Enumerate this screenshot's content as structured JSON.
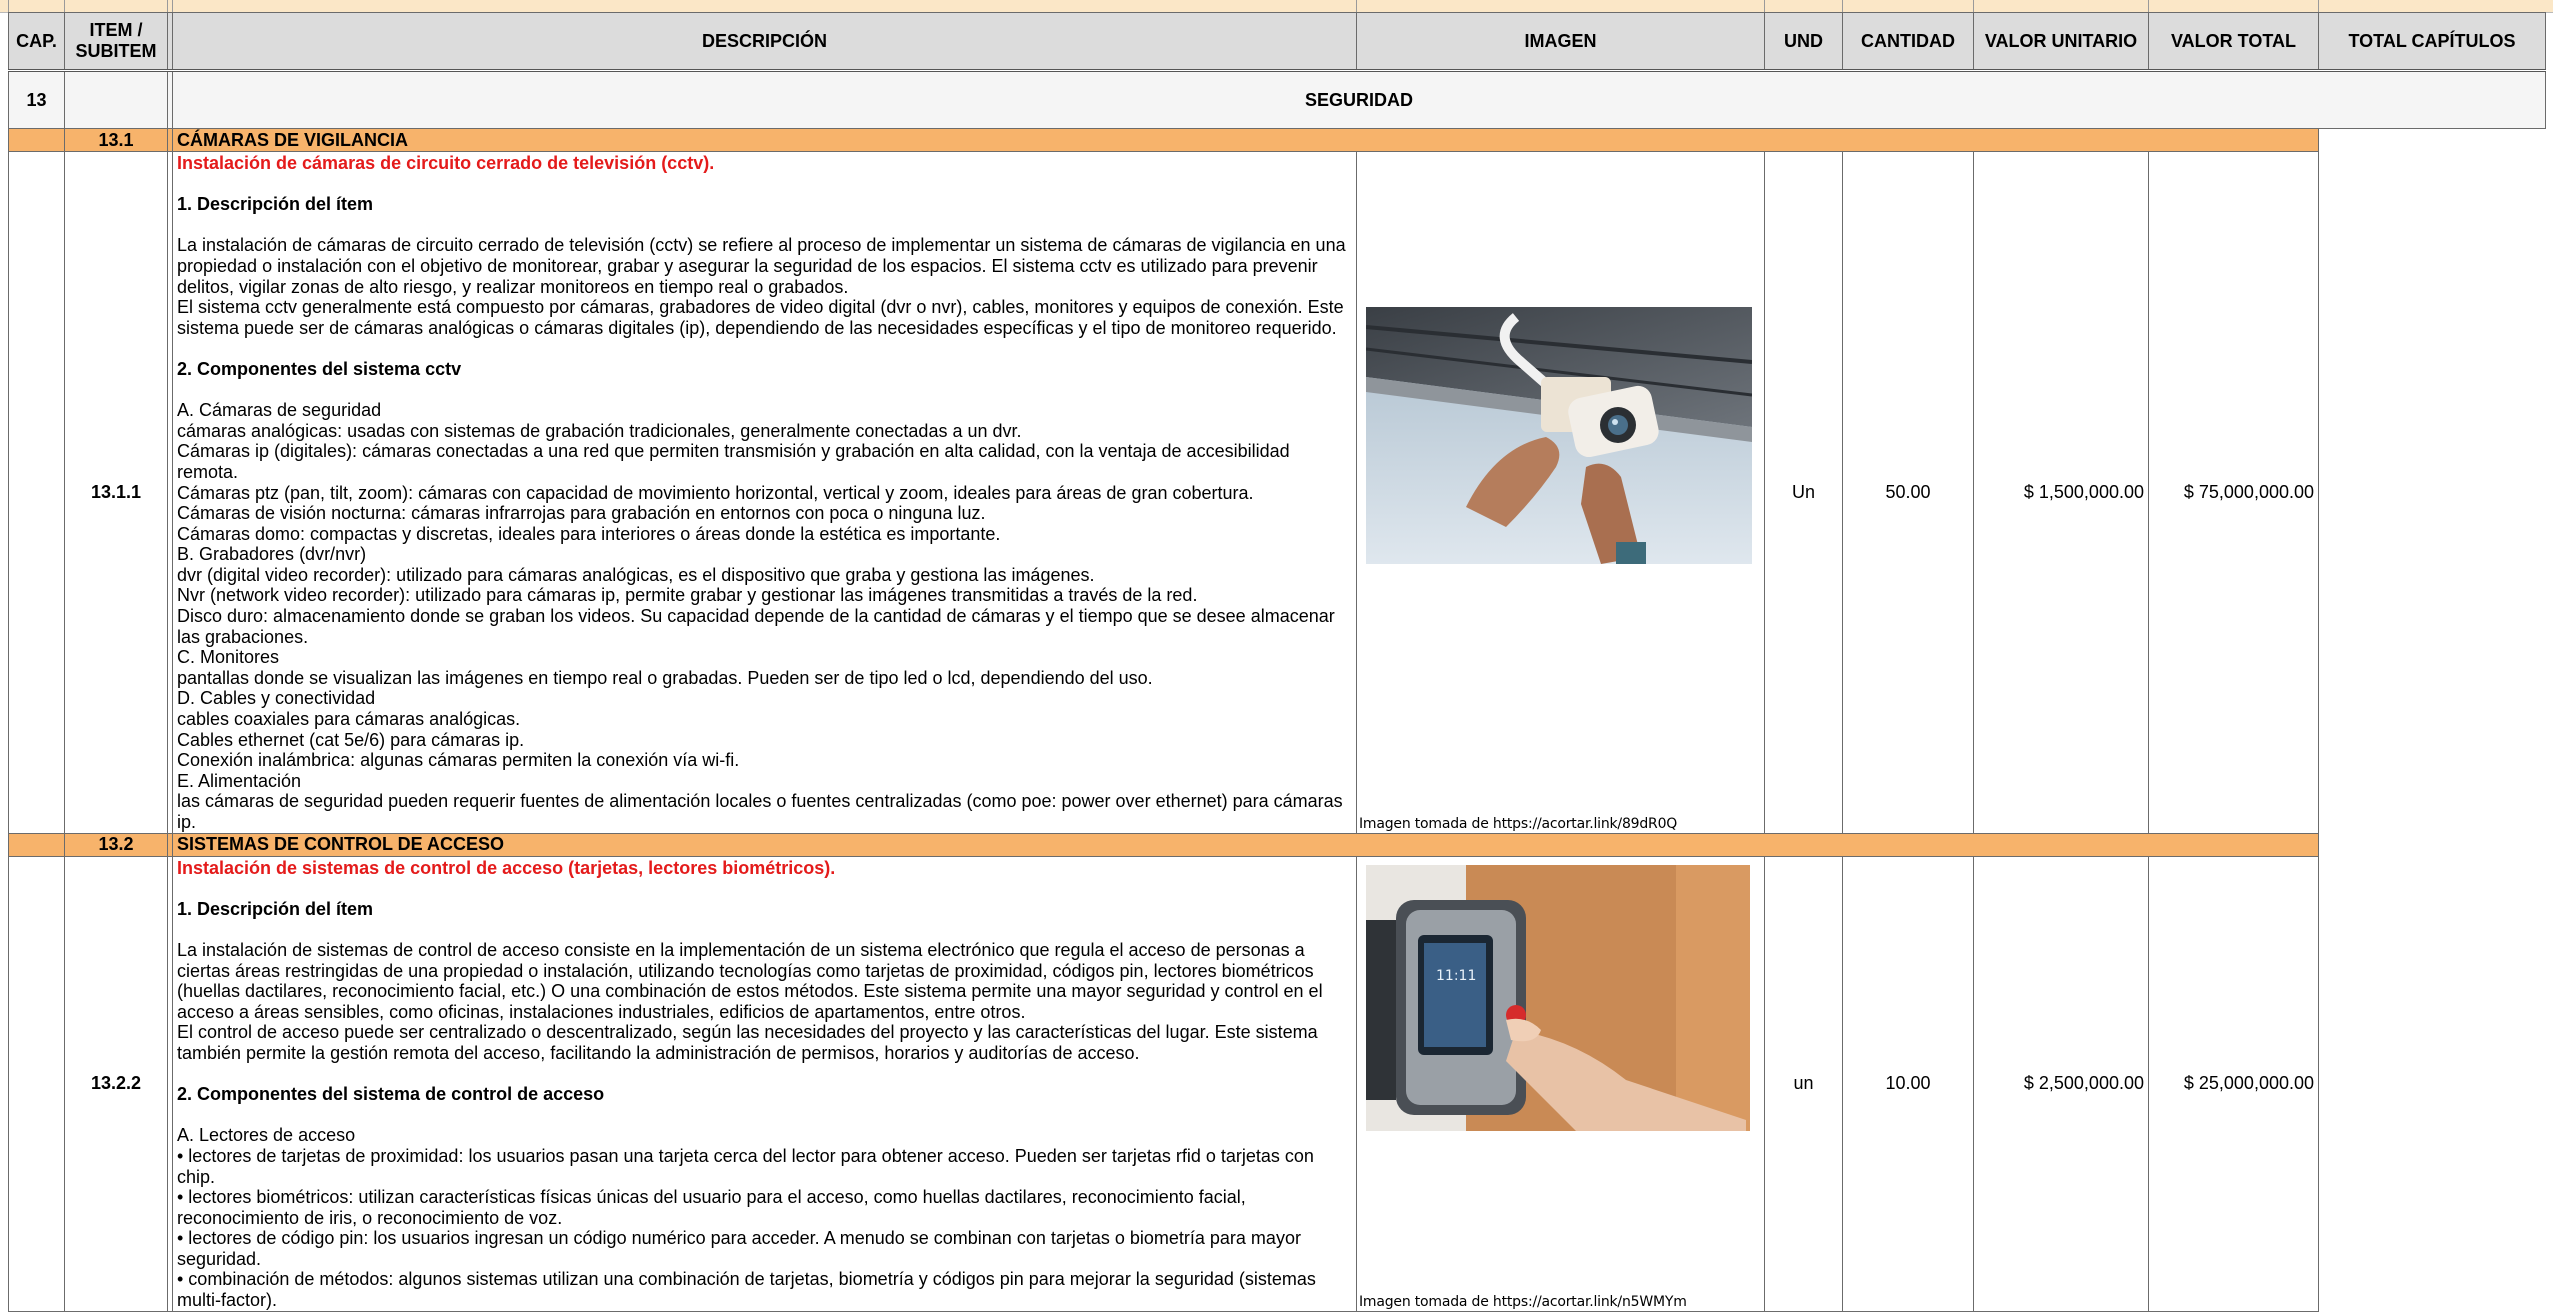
{
  "headers": {
    "cap": "CAP.",
    "item": "ITEM /\nSUBITEM",
    "item_line1": "ITEM /",
    "item_line2": "SUBITEM",
    "descripcion": "DESCRIPCIÓN",
    "imagen": "IMAGEN",
    "und": "UND",
    "cantidad": "CANTIDAD",
    "valor_unitario": "VALOR UNITARIO",
    "valor_total": "VALOR TOTAL",
    "total_capitulos": "TOTAL CAPÍTULOS"
  },
  "chapter": {
    "number": "13",
    "title": "SEGURIDAD"
  },
  "sections": [
    {
      "code": "13.1",
      "title": "CÁMARAS DE VIGILANCIA",
      "item": {
        "code": "13.1.1",
        "red_title": "Instalación de cámaras de circuito cerrado de televisión (cctv).",
        "heading1": "1. Descripción del ítem",
        "para1_lines": [
          "La instalación de cámaras de circuito cerrado de televisión (cctv) se refiere al proceso de implementar un sistema de cámaras de vigilancia en una",
          "propiedad o instalación con el objetivo de monitorear, grabar y asegurar la seguridad de los espacios. El sistema cctv es utilizado para prevenir",
          "delitos, vigilar zonas de alto riesgo, y realizar monitoreos en tiempo real o grabados.",
          "El sistema cctv generalmente está compuesto por cámaras, grabadores de video digital (dvr o nvr), cables, monitores y equipos de conexión. Este",
          "sistema puede ser de cámaras analógicas o cámaras digitales (ip), dependiendo de las necesidades específicas y el tipo de monitoreo requerido."
        ],
        "heading2": "2. Componentes del sistema cctv",
        "list_lines": [
          "A. Cámaras de seguridad",
          "cámaras analógicas: usadas con sistemas de grabación tradicionales, generalmente conectadas a un dvr.",
          "Cámaras ip (digitales): cámaras conectadas a una red que permiten transmisión y grabación en alta calidad, con la ventaja de accesibilidad remota.",
          "Cámaras ptz (pan, tilt, zoom): cámaras con capacidad de movimiento horizontal, vertical y zoom, ideales para áreas de gran cobertura.",
          "Cámaras de visión nocturna: cámaras infrarrojas para grabación en entornos con poca o ninguna luz.",
          "Cámaras domo: compactas y discretas, ideales para interiores o áreas donde la estética es importante.",
          "B. Grabadores (dvr/nvr)",
          "dvr (digital video recorder): utilizado para cámaras analógicas, es el dispositivo que graba y gestiona las imágenes.",
          "Nvr (network video recorder): utilizado para cámaras ip, permite grabar y gestionar las imágenes transmitidas a través de la red.",
          "Disco duro: almacenamiento donde se graban los videos. Su capacidad depende de la cantidad de cámaras y el tiempo que se desee almacenar",
          "las grabaciones.",
          "C. Monitores",
          "pantallas donde se visualizan las imágenes en tiempo real o grabadas. Pueden ser de tipo led o lcd, dependiendo del uso.",
          "D. Cables y conectividad",
          "cables coaxiales para cámaras analógicas.",
          "Cables ethernet (cat 5e/6) para cámaras ip.",
          "Conexión inalámbrica: algunas cámaras permiten la conexión vía wi-fi.",
          "E. Alimentación",
          "las cámaras de seguridad pueden requerir fuentes de alimentación locales o fuentes centralizadas (como poe: power over ethernet) para cámaras",
          "ip."
        ],
        "image_credit": "Imagen tomada de https://acortar.link/89dR0Q",
        "und": "Un",
        "cantidad": "50.00",
        "valor_unitario": "$ 1,500,000.00",
        "valor_total": "$ 75,000,000.00"
      }
    },
    {
      "code": "13.2",
      "title": "SISTEMAS DE CONTROL DE ACCESO",
      "item": {
        "code": "13.2.2",
        "red_title": "Instalación de sistemas de control de acceso (tarjetas, lectores biométricos).",
        "heading1": "1. Descripción del ítem",
        "para1_lines": [
          "La instalación de sistemas de control de acceso consiste en la implementación de un sistema electrónico que regula el acceso de personas a",
          "ciertas áreas restringidas de una propiedad o instalación, utilizando tecnologías como tarjetas de proximidad, códigos pin, lectores biométricos",
          "(huellas dactilares, reconocimiento facial, etc.) O una combinación de estos métodos. Este sistema permite una mayor seguridad y control en el",
          "acceso a áreas sensibles, como oficinas, instalaciones industriales, edificios de apartamentos, entre otros.",
          "El control de acceso puede ser centralizado o descentralizado, según las necesidades del proyecto y las características del lugar. Este sistema",
          "también permite la gestión remota del acceso, facilitando la administración de permisos, horarios y auditorías de acceso."
        ],
        "heading2": "2. Componentes del sistema de control de acceso",
        "list_lines": [
          "A. Lectores de acceso",
          "• lectores de tarjetas de proximidad: los usuarios pasan una tarjeta cerca del lector para obtener acceso. Pueden ser tarjetas rfid o tarjetas con chip.",
          "• lectores biométricos: utilizan características físicas únicas del usuario para el acceso, como huellas dactilares, reconocimiento facial,",
          "reconocimiento de iris, o reconocimiento de voz.",
          "• lectores de código pin: los usuarios ingresan un código numérico para acceder. A menudo se combinan con tarjetas o biometría para mayor",
          "seguridad.",
          "• combinación de métodos: algunos sistemas utilizan una combinación de tarjetas, biometría y códigos pin para mejorar la seguridad (sistemas",
          "multi-factor)."
        ],
        "image_credit": "Imagen tomada de https://acortar.link/n5WMYm",
        "und": "un",
        "cantidad": "10.00",
        "valor_unitario": "$ 2,500,000.00",
        "valor_total": "$ 25,000,000.00"
      }
    }
  ],
  "colors": {
    "header_bg": "#dcdcdc",
    "subsection_bg": "#f7b36b",
    "item_title": "#e41b1b",
    "top_strip": "#fbe7c7"
  },
  "icons": [
    "cctv-camera-photo",
    "biometric-reader-photo"
  ]
}
